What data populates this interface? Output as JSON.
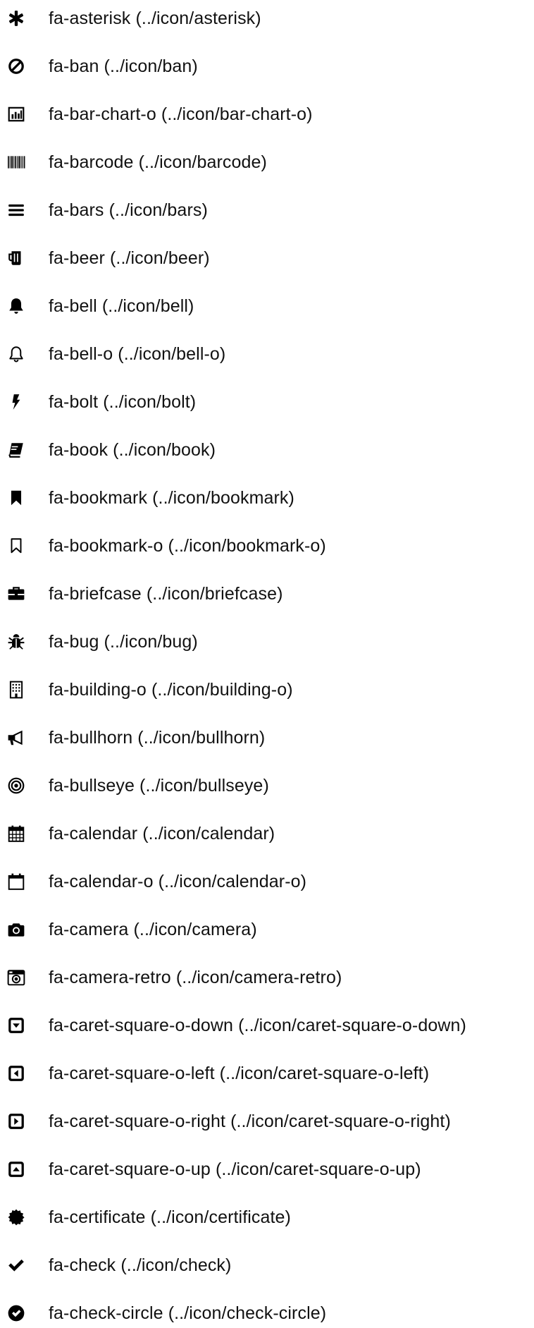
{
  "icons": [
    {
      "name": "fa-asterisk",
      "path": "(../icon/asterisk)",
      "icon": "asterisk-icon"
    },
    {
      "name": "fa-ban",
      "path": "(../icon/ban)",
      "icon": "ban-icon"
    },
    {
      "name": "fa-bar-chart-o",
      "path": "(../icon/bar-chart-o)",
      "icon": "bar-chart-icon"
    },
    {
      "name": "fa-barcode",
      "path": "(../icon/barcode)",
      "icon": "barcode-icon"
    },
    {
      "name": "fa-bars",
      "path": "(../icon/bars)",
      "icon": "bars-icon"
    },
    {
      "name": "fa-beer",
      "path": "(../icon/beer)",
      "icon": "beer-icon"
    },
    {
      "name": "fa-bell",
      "path": "(../icon/bell)",
      "icon": "bell-icon"
    },
    {
      "name": "fa-bell-o",
      "path": "(../icon/bell-o)",
      "icon": "bell-outline-icon"
    },
    {
      "name": "fa-bolt",
      "path": "(../icon/bolt)",
      "icon": "bolt-icon"
    },
    {
      "name": "fa-book",
      "path": "(../icon/book)",
      "icon": "book-icon"
    },
    {
      "name": "fa-bookmark",
      "path": "(../icon/bookmark)",
      "icon": "bookmark-icon"
    },
    {
      "name": "fa-bookmark-o",
      "path": "(../icon/bookmark-o)",
      "icon": "bookmark-outline-icon"
    },
    {
      "name": "fa-briefcase",
      "path": "(../icon/briefcase)",
      "icon": "briefcase-icon"
    },
    {
      "name": "fa-bug",
      "path": "(../icon/bug)",
      "icon": "bug-icon"
    },
    {
      "name": "fa-building-o",
      "path": "(../icon/building-o)",
      "icon": "building-icon"
    },
    {
      "name": "fa-bullhorn",
      "path": "(../icon/bullhorn)",
      "icon": "bullhorn-icon"
    },
    {
      "name": "fa-bullseye",
      "path": "(../icon/bullseye)",
      "icon": "bullseye-icon"
    },
    {
      "name": "fa-calendar",
      "path": "(../icon/calendar)",
      "icon": "calendar-icon"
    },
    {
      "name": "fa-calendar-o",
      "path": "(../icon/calendar-o)",
      "icon": "calendar-outline-icon"
    },
    {
      "name": "fa-camera",
      "path": "(../icon/camera)",
      "icon": "camera-icon"
    },
    {
      "name": "fa-camera-retro",
      "path": "(../icon/camera-retro)",
      "icon": "camera-retro-icon"
    },
    {
      "name": "fa-caret-square-o-down",
      "path": "(../icon/caret-square-o-down)",
      "icon": "caret-square-down-icon"
    },
    {
      "name": "fa-caret-square-o-left",
      "path": "(../icon/caret-square-o-left)",
      "icon": "caret-square-left-icon"
    },
    {
      "name": "fa-caret-square-o-right",
      "path": "(../icon/caret-square-o-right)",
      "icon": "caret-square-right-icon"
    },
    {
      "name": "fa-caret-square-o-up",
      "path": "(../icon/caret-square-o-up)",
      "icon": "caret-square-up-icon"
    },
    {
      "name": "fa-certificate",
      "path": "(../icon/certificate)",
      "icon": "certificate-icon"
    },
    {
      "name": "fa-check",
      "path": "(../icon/check)",
      "icon": "check-icon"
    },
    {
      "name": "fa-check-circle",
      "path": "(../icon/check-circle)",
      "icon": "check-circle-icon"
    }
  ]
}
